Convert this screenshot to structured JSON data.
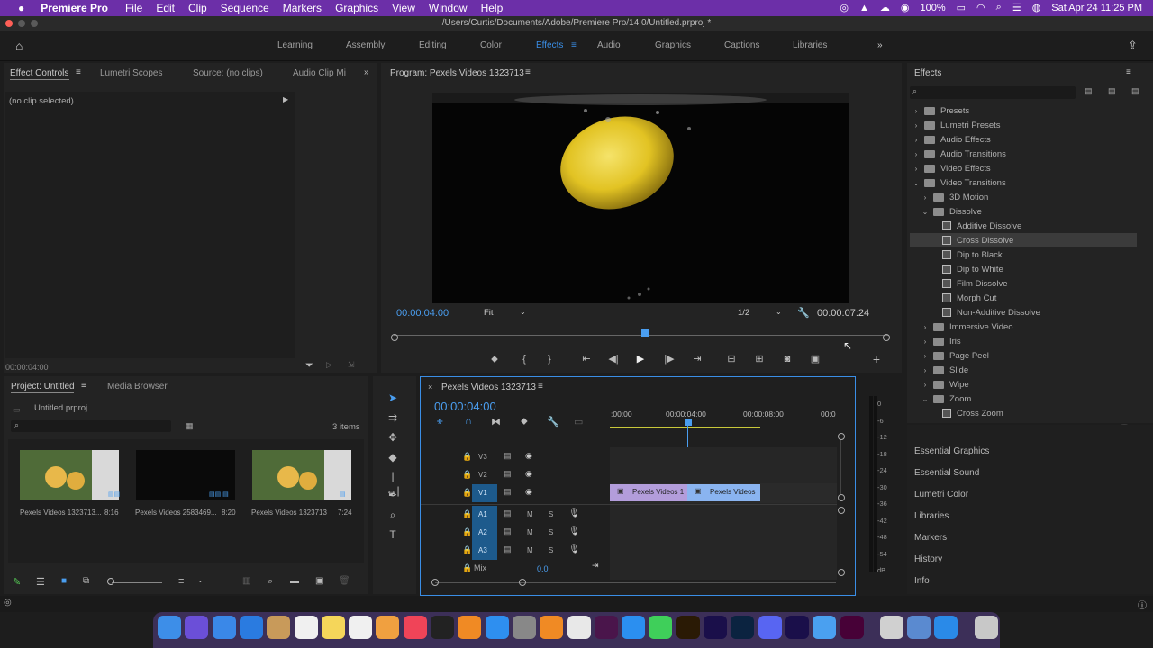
{
  "menubar": {
    "app": "Premiere Pro",
    "items": [
      "File",
      "Edit",
      "Clip",
      "Sequence",
      "Markers",
      "Graphics",
      "View",
      "Window",
      "Help"
    ],
    "battery": "100%",
    "datetime": "Sat Apr 24  11:25 PM"
  },
  "titlebar": {
    "path": "/Users/Curtis/Documents/Adobe/Premiere Pro/14.0/Untitled.prproj *"
  },
  "workspaces": {
    "tabs": [
      "Learning",
      "Assembly",
      "Editing",
      "Color",
      "Effects",
      "Audio",
      "Graphics",
      "Captions",
      "Libraries"
    ],
    "active": "Effects"
  },
  "source_panel": {
    "tabs": [
      "Effect Controls",
      "Lumetri Scopes",
      "Source: (no clips)",
      "Audio Clip Mi"
    ],
    "message": "(no clip selected)",
    "timecode": "00:00:04:00"
  },
  "program": {
    "title": "Program: Pexels Videos 1323713",
    "timecode": "00:00:04:00",
    "fit": "Fit",
    "resolution": "1/2",
    "duration": "00:00:07:24",
    "playhead_fraction": 0.51
  },
  "effects": {
    "title": "Effects",
    "tree": [
      {
        "label": "Presets",
        "level": 0,
        "type": "folder",
        "caret": "›"
      },
      {
        "label": "Lumetri Presets",
        "level": 0,
        "type": "folder",
        "caret": "›"
      },
      {
        "label": "Audio Effects",
        "level": 0,
        "type": "folder",
        "caret": "›"
      },
      {
        "label": "Audio Transitions",
        "level": 0,
        "type": "folder",
        "caret": "›"
      },
      {
        "label": "Video Effects",
        "level": 0,
        "type": "folder",
        "caret": "›"
      },
      {
        "label": "Video Transitions",
        "level": 0,
        "type": "folder",
        "caret": "⌄"
      },
      {
        "label": "3D Motion",
        "level": 1,
        "type": "folder",
        "caret": "›"
      },
      {
        "label": "Dissolve",
        "level": 1,
        "type": "folder",
        "caret": "⌄"
      },
      {
        "label": "Additive Dissolve",
        "level": 2,
        "type": "fx"
      },
      {
        "label": "Cross Dissolve",
        "level": 2,
        "type": "fx",
        "selected": true
      },
      {
        "label": "Dip to Black",
        "level": 2,
        "type": "fx"
      },
      {
        "label": "Dip to White",
        "level": 2,
        "type": "fx"
      },
      {
        "label": "Film Dissolve",
        "level": 2,
        "type": "fx"
      },
      {
        "label": "Morph Cut",
        "level": 2,
        "type": "fx"
      },
      {
        "label": "Non-Additive Dissolve",
        "level": 2,
        "type": "fx"
      },
      {
        "label": "Immersive Video",
        "level": 1,
        "type": "folder",
        "caret": "›"
      },
      {
        "label": "Iris",
        "level": 1,
        "type": "folder",
        "caret": "›"
      },
      {
        "label": "Page Peel",
        "level": 1,
        "type": "folder",
        "caret": "›"
      },
      {
        "label": "Slide",
        "level": 1,
        "type": "folder",
        "caret": "›"
      },
      {
        "label": "Wipe",
        "level": 1,
        "type": "folder",
        "caret": "›"
      },
      {
        "label": "Zoom",
        "level": 1,
        "type": "folder",
        "caret": "⌄"
      },
      {
        "label": "Cross Zoom",
        "level": 2,
        "type": "fx"
      }
    ],
    "side_panels": [
      "Essential Graphics",
      "Essential Sound",
      "Lumetri Color",
      "Libraries",
      "Markers",
      "History",
      "Info"
    ]
  },
  "project": {
    "tabs": [
      "Project: Untitled",
      "Media Browser"
    ],
    "file": "Untitled.prproj",
    "count": "3 items",
    "items": [
      {
        "name": "Pexels Videos 1323713...",
        "duration": "8:16"
      },
      {
        "name": "Pexels Videos 2583469...",
        "duration": "8:20"
      },
      {
        "name": "Pexels Videos 1323713",
        "duration": "7:24"
      }
    ]
  },
  "timeline": {
    "title": "Pexels Videos 1323713",
    "timecode": "00:00:04:00",
    "ruler": [
      ":00:00",
      "00:00:04:00",
      "00:00:08:00",
      "00:0"
    ],
    "video_tracks": [
      "V3",
      "V2",
      "V1"
    ],
    "audio_tracks": [
      "A1",
      "A2",
      "A3"
    ],
    "mix_label": "Mix",
    "mix_value": "0.0",
    "clips": [
      {
        "label": "Pexels Videos 1",
        "color": "#b39ddb"
      },
      {
        "label": "Pexels Videos",
        "color": "#8ab4f0"
      }
    ]
  },
  "meter": {
    "labels": [
      "0",
      "-6",
      "-12",
      "-18",
      "-24",
      "-30",
      "-36",
      "-42",
      "-48",
      "-54",
      "dB"
    ]
  },
  "colors": {
    "accent": "#3a8ee6",
    "timecode": "#4a9ef0",
    "menubar": "#6c2fa8"
  }
}
